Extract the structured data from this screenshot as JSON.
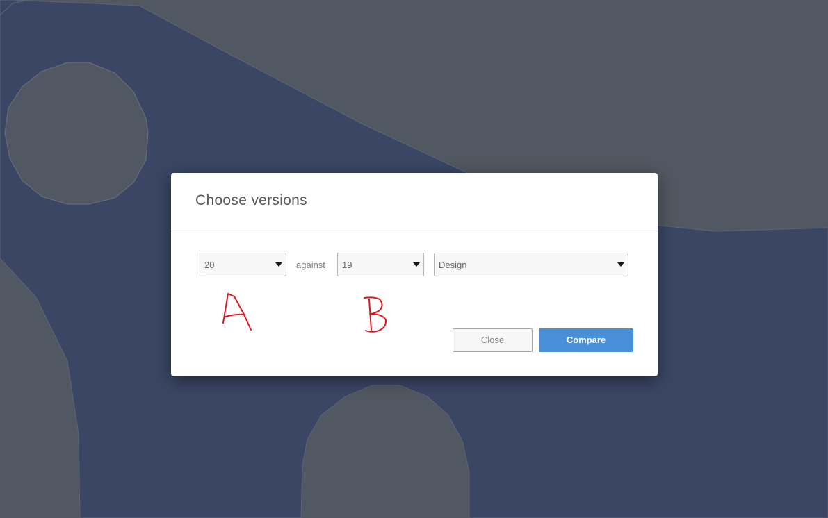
{
  "colors": {
    "viewport_blue": "#3a4664",
    "viewport_gray": "#525861",
    "annotation_red": "#e0161c",
    "primary_button": "#4a90d9"
  },
  "dialog": {
    "title": "Choose versions",
    "version_a": {
      "selected": "20"
    },
    "separator_label": "against",
    "version_b": {
      "selected": "19"
    },
    "scope": {
      "selected": "Design"
    },
    "close_label": "Close",
    "compare_label": "Compare"
  },
  "annotations": {
    "label_a": "A",
    "label_b": "B"
  }
}
